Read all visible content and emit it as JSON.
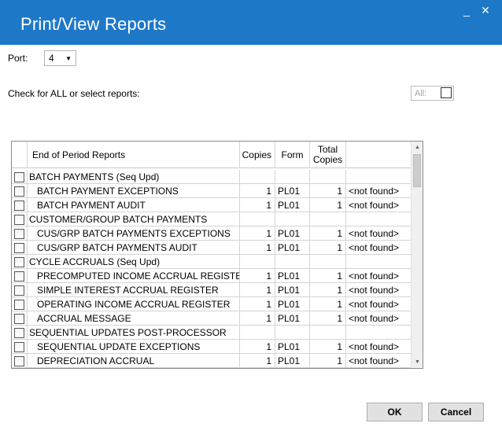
{
  "window": {
    "title": "Print/View Reports",
    "minimize_glyph": "_",
    "close_glyph": "✕"
  },
  "port": {
    "label": "Port:",
    "value": "4"
  },
  "check_label": "Check for ALL or select reports:",
  "all_toggle": {
    "label": "All:"
  },
  "grid": {
    "headers": {
      "name": "End of Period Reports",
      "copies": "Copies",
      "form": "Form",
      "total_line1": "Total",
      "total_line2": "Copies",
      "file": ""
    },
    "rows": [
      {
        "name": "BATCH PAYMENTS (Seq Upd)",
        "copies": "",
        "form": "",
        "total": "",
        "file": "",
        "sub": false
      },
      {
        "name": "BATCH PAYMENT EXCEPTIONS",
        "copies": "1",
        "form": "PL01",
        "total": "1",
        "file": "<not found>",
        "sub": true
      },
      {
        "name": "BATCH PAYMENT AUDIT",
        "copies": "1",
        "form": "PL01",
        "total": "1",
        "file": "<not found>",
        "sub": true
      },
      {
        "name": "CUSTOMER/GROUP BATCH PAYMENTS",
        "copies": "",
        "form": "",
        "total": "",
        "file": "",
        "sub": false
      },
      {
        "name": "CUS/GRP BATCH PAYMENTS EXCEPTIONS",
        "copies": "1",
        "form": "PL01",
        "total": "1",
        "file": "<not found>",
        "sub": true
      },
      {
        "name": "CUS/GRP BATCH PAYMENTS AUDIT",
        "copies": "1",
        "form": "PL01",
        "total": "1",
        "file": "<not found>",
        "sub": true
      },
      {
        "name": "CYCLE ACCRUALS (Seq Upd)",
        "copies": "",
        "form": "",
        "total": "",
        "file": "",
        "sub": false
      },
      {
        "name": "PRECOMPUTED INCOME ACCRUAL REGISTER",
        "copies": "1",
        "form": "PL01",
        "total": "1",
        "file": "<not found>",
        "sub": true
      },
      {
        "name": "SIMPLE INTEREST ACCRUAL REGISTER",
        "copies": "1",
        "form": "PL01",
        "total": "1",
        "file": "<not found>",
        "sub": true
      },
      {
        "name": "OPERATING INCOME ACCRUAL REGISTER",
        "copies": "1",
        "form": "PL01",
        "total": "1",
        "file": "<not found>",
        "sub": true
      },
      {
        "name": "ACCRUAL MESSAGE",
        "copies": "1",
        "form": "PL01",
        "total": "1",
        "file": "<not found>",
        "sub": true
      },
      {
        "name": "SEQUENTIAL UPDATES POST-PROCESSOR",
        "copies": "",
        "form": "",
        "total": "",
        "file": "",
        "sub": false
      },
      {
        "name": "SEQUENTIAL UPDATE EXCEPTIONS",
        "copies": "1",
        "form": "PL01",
        "total": "1",
        "file": "<not found>",
        "sub": true
      },
      {
        "name": "DEPRECIATION ACCRUAL",
        "copies": "1",
        "form": "PL01",
        "total": "1",
        "file": "<not found>",
        "sub": true
      }
    ]
  },
  "buttons": {
    "ok": "OK",
    "cancel": "Cancel"
  }
}
